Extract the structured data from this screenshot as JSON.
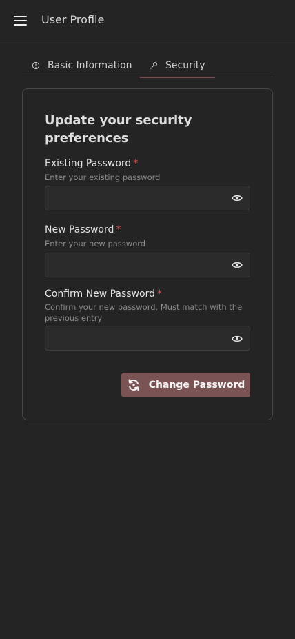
{
  "header": {
    "menu_icon": "hamburger-menu-icon",
    "title": "User Profile"
  },
  "tabs": [
    {
      "label": "Basic Information",
      "icon": "info-icon",
      "active": false
    },
    {
      "label": "Security",
      "icon": "key-icon",
      "active": true
    }
  ],
  "form": {
    "heading": "Update your security preferences",
    "required_marker": "*",
    "fields": [
      {
        "label": "Existing Password",
        "hint": "Enter your existing password",
        "value": "",
        "placeholder": ""
      },
      {
        "label": "New Password",
        "hint": "Enter your new password",
        "value": "",
        "placeholder": ""
      },
      {
        "label": "Confirm New Password",
        "hint": "Confirm your new password. Must match with the previous entry",
        "value": "",
        "placeholder": ""
      }
    ],
    "visibility_toggle_icon": "eye-icon",
    "submit_label": "Change Password",
    "submit_icon": "refresh-icon"
  },
  "colors": {
    "background": "#242424",
    "accent": "#7a5454",
    "required": "#d9534f"
  }
}
